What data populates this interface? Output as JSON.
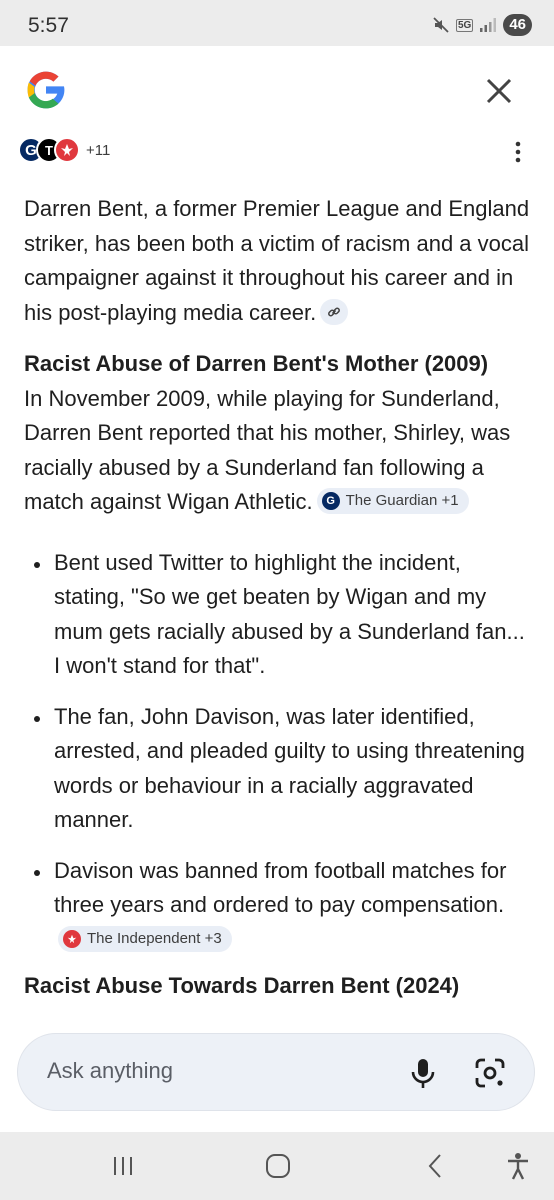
{
  "status_bar": {
    "time": "5:57",
    "network": "5G",
    "battery": "46"
  },
  "header": {
    "logo": "google-g-logo",
    "close_icon": "close-icon",
    "sources_more": "+11",
    "menu_icon": "more-vertical-icon"
  },
  "answer": {
    "intro": "Darren Bent, a former Premier League and England striker, has been both a victim of racism and a vocal campaigner against it throughout his career and in his post-playing media career.",
    "section1_heading": "Racist Abuse of Darren Bent's Mother (2009)",
    "section1_text": "In November 2009, while playing for Sunderland, Darren Bent reported that his mother, Shirley, was racially abused by a Sunderland fan following a match against Wigan Athletic.",
    "section1_citation": "The Guardian +1",
    "bullets": [
      {
        "text": "Bent used Twitter to highlight the incident, stating, \"So we get beaten by Wigan and my mum gets racially abused by a Sunderland fan... I won't stand for that\"."
      },
      {
        "text": "The fan, John Davison, was later identified, arrested, and pleaded guilty to using threatening words or behaviour in a racially aggravated manner."
      },
      {
        "text": "Davison was banned from football matches for three years and ordered to pay compensation.",
        "citation": "The Independent +3"
      }
    ],
    "section2_heading": "Racist Abuse Towards Darren Bent (2024)"
  },
  "ask_bar": {
    "placeholder": "Ask anything",
    "mic_icon": "microphone-icon",
    "lens_icon": "google-lens-icon"
  },
  "nav_bar": {
    "recents_icon": "recents-icon",
    "home_icon": "home-icon",
    "back_icon": "back-icon",
    "accessibility_icon": "accessibility-icon"
  },
  "colors": {
    "accent_blue": "#4285f4",
    "accent_red": "#ea4335",
    "accent_yellow": "#fbbc05",
    "accent_green": "#34a853",
    "chip_bg": "#e9eef6",
    "guardian_blue": "#052962",
    "independent_red": "#e0383e"
  }
}
